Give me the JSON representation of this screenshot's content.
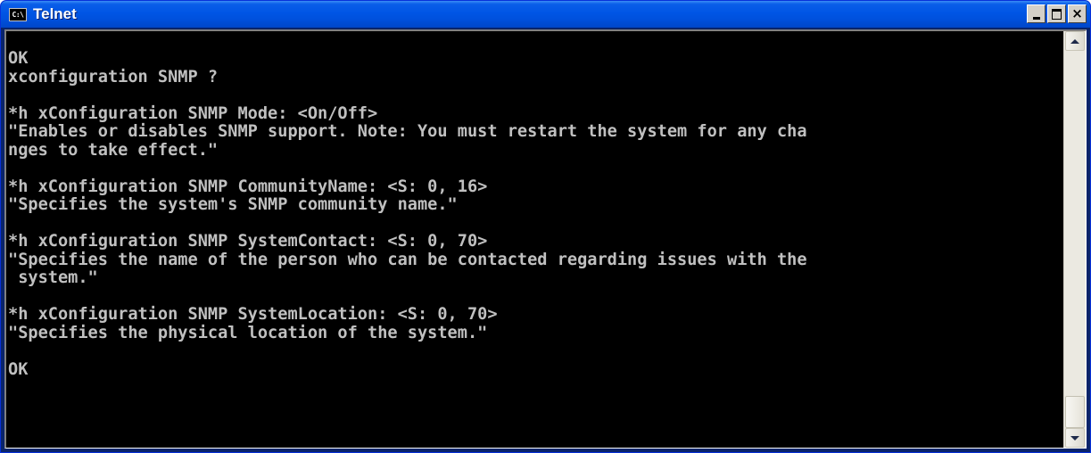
{
  "window": {
    "title": "Telnet",
    "app_icon_text": "C:\\",
    "controls": {
      "minimize": "_",
      "maximize": "□",
      "close": "×"
    }
  },
  "console": {
    "lines": [
      "OK",
      "xconfiguration SNMP ?",
      "",
      "*h xConfiguration SNMP Mode: <On/Off>",
      "\"Enables or disables SNMP support. Note: You must restart the system for any cha",
      "nges to take effect.\"",
      "",
      "*h xConfiguration SNMP CommunityName: <S: 0, 16>",
      "\"Specifies the system's SNMP community name.\"",
      "",
      "*h xConfiguration SNMP SystemContact: <S: 0, 70>",
      "\"Specifies the name of the person who can be contacted regarding issues with the",
      " system.\"",
      "",
      "*h xConfiguration SNMP SystemLocation: <S: 0, 70>",
      "\"Specifies the physical location of the system.\"",
      "",
      "OK"
    ],
    "scroll_position": 1.0
  },
  "colors": {
    "console_bg": "#000000",
    "console_text": "#c0c0c0",
    "titlebar": "#0055e5"
  }
}
